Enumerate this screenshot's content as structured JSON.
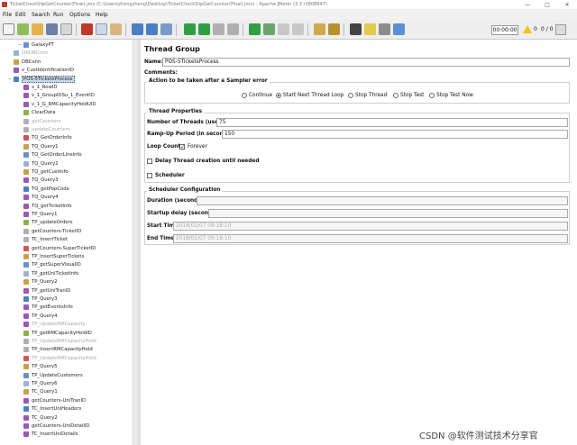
{
  "window": {
    "title": "TicketCheckSlipGetCounter(Final).jmx (C:\\Users\\zhengzheng\\Desktop\\TicketCheckSlipGetCounter(Final).jmx) - Apache JMeter (3.3 r1808647)"
  },
  "menu": {
    "items": [
      "File",
      "Edit",
      "Search",
      "Run",
      "Options",
      "Help"
    ]
  },
  "toolbar": {
    "timer": "00:00:00",
    "warnings": "0",
    "threads": "0 / 0"
  },
  "tree": {
    "items": [
      {
        "label": "GalaxyPT",
        "state": "normal"
      },
      {
        "label": "QADBConn",
        "state": "disabled"
      },
      {
        "label": "DBConn",
        "state": "normal"
      },
      {
        "label": "v_CustIdentificationID",
        "state": "normal"
      },
      {
        "label": "POS-5TicketsProcess",
        "state": "selected"
      },
      {
        "label": "v_1_RowID",
        "state": "normal"
      },
      {
        "label": "v_1_GroupIDSu_1_EventID",
        "state": "normal"
      },
      {
        "label": "v_1_G_RMCapacityHoldUID",
        "state": "normal"
      },
      {
        "label": "ClearData",
        "state": "normal"
      },
      {
        "label": "getCounters",
        "state": "disabled"
      },
      {
        "label": "updateCounters",
        "state": "disabled"
      },
      {
        "label": "TQ_GetOrderInfo",
        "state": "normal"
      },
      {
        "label": "TQ_Query1",
        "state": "normal"
      },
      {
        "label": "TQ_GetOrderLineInfo",
        "state": "normal"
      },
      {
        "label": "TQ_Query2",
        "state": "normal"
      },
      {
        "label": "TQ_getCustInfo",
        "state": "normal"
      },
      {
        "label": "TQ_Query3",
        "state": "normal"
      },
      {
        "label": "TQ_getPopCode",
        "state": "normal"
      },
      {
        "label": "TQ_Query4",
        "state": "normal"
      },
      {
        "label": "TQ_getTicketInfo",
        "state": "normal"
      },
      {
        "label": "TP_Query1",
        "state": "normal"
      },
      {
        "label": "TP_updateOrders",
        "state": "normal"
      },
      {
        "label": "getCounters-TicketID",
        "state": "normal"
      },
      {
        "label": "TC_InsertTicket",
        "state": "normal"
      },
      {
        "label": "getCounters-SuperTicketID",
        "state": "normal"
      },
      {
        "label": "TP_InsertSuperTickets",
        "state": "normal"
      },
      {
        "label": "TP_getSuperVisualID",
        "state": "normal"
      },
      {
        "label": "TP_getUniTicketInfo",
        "state": "normal"
      },
      {
        "label": "TP_Query2",
        "state": "normal"
      },
      {
        "label": "TP_getUniTranID",
        "state": "normal"
      },
      {
        "label": "TP_Query3",
        "state": "normal"
      },
      {
        "label": "TP_getEventsInfo",
        "state": "normal"
      },
      {
        "label": "TP_Query4",
        "state": "normal"
      },
      {
        "label": "TP_UpdateRMCapacity",
        "state": "disabled"
      },
      {
        "label": "TP_getRMCapacityHoldID",
        "state": "normal"
      },
      {
        "label": "TP_UpdateRMCapacityHold",
        "state": "disabled"
      },
      {
        "label": "TP_InsertRMCapacityHold",
        "state": "normal"
      },
      {
        "label": "TP_UpdateRMCapacityHold",
        "state": "disabled"
      },
      {
        "label": "TP_Query5",
        "state": "normal"
      },
      {
        "label": "TP_UpdateCustomers",
        "state": "normal"
      },
      {
        "label": "TP_Query6",
        "state": "normal"
      },
      {
        "label": "TC_Query1",
        "state": "normal"
      },
      {
        "label": "getCounters-UniTranID",
        "state": "normal"
      },
      {
        "label": "TC_InsertUniHeaders",
        "state": "normal"
      },
      {
        "label": "TC_Query2",
        "state": "normal"
      },
      {
        "label": "getCounters-UniDetailID",
        "state": "normal"
      },
      {
        "label": "TC_InsertUniDetails",
        "state": "normal"
      }
    ]
  },
  "main": {
    "title": "Thread Group",
    "name_label": "Name:",
    "name_value": "POS-5TicketsProcess",
    "comments_label": "Comments:",
    "sampler_error": {
      "title": "Action to be taken after a Sampler error",
      "options": [
        "Continue",
        "Start Next Thread Loop",
        "Stop Thread",
        "Stop Test",
        "Stop Test Now"
      ],
      "selected": "Start Next Thread Loop"
    },
    "thread_props": {
      "title": "Thread Properties",
      "threads_label": "Number of Threads (users):",
      "threads_value": "75",
      "rampup_label": "Ramp-Up Period (in seconds):",
      "rampup_value": "150",
      "loop_label": "Loop Count:",
      "forever_label": "Forever",
      "delay_label": "Delay Thread creation until needed",
      "scheduler_label": "Scheduler"
    },
    "scheduler": {
      "title": "Scheduler Configuration",
      "duration_label": "Duration (seconds)",
      "startup_label": "Startup delay (seconds)",
      "start_label": "Start Time",
      "start_value": "2018/02/07 09:18:10",
      "end_label": "End Time",
      "end_value": "2018/02/07 09:18:10"
    }
  },
  "watermark": "CSDN @软件测试技术分享官"
}
